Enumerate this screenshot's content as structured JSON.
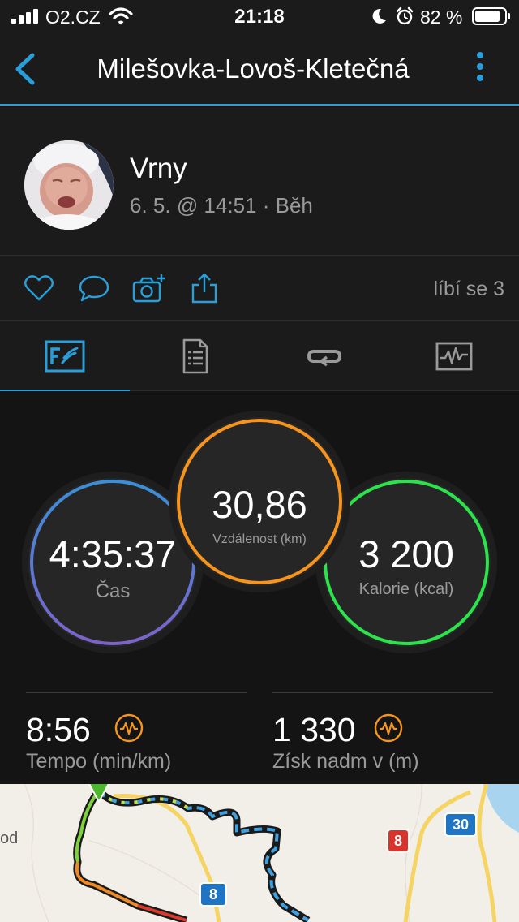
{
  "status_bar": {
    "carrier": "O2.CZ",
    "time": "21:18",
    "battery": "82 %"
  },
  "nav": {
    "title": "Milešovka-Lovoš-Kletečná"
  },
  "profile": {
    "name": "Vrny",
    "meta": "6. 5. @ 14:51 · Běh"
  },
  "actions": {
    "likes": "líbí se 3"
  },
  "tabs": [
    "overview-icon",
    "details-icon",
    "laps-icon",
    "graphs-icon"
  ],
  "stats": {
    "distance": {
      "value": "30,86",
      "label": "Vzdálenost (km)",
      "color": "#f7941d"
    },
    "time": {
      "value": "4:35:37",
      "label": "Čas",
      "color": "#3b8fd8"
    },
    "calories": {
      "value": "3 200",
      "label": "Kalorie (kcal)",
      "color": "#2be34a"
    }
  },
  "metrics": [
    {
      "value": "8:56",
      "label": "Tempo (min/km)"
    },
    {
      "value": "1 330",
      "label": "Získ nadm v (m)"
    }
  ],
  "map": {
    "road_labels": [
      "8",
      "8",
      "30"
    ],
    "place_fragment": "od"
  },
  "colors": {
    "accent": "#2a9ed8",
    "metric_icon": "#f7941d"
  }
}
